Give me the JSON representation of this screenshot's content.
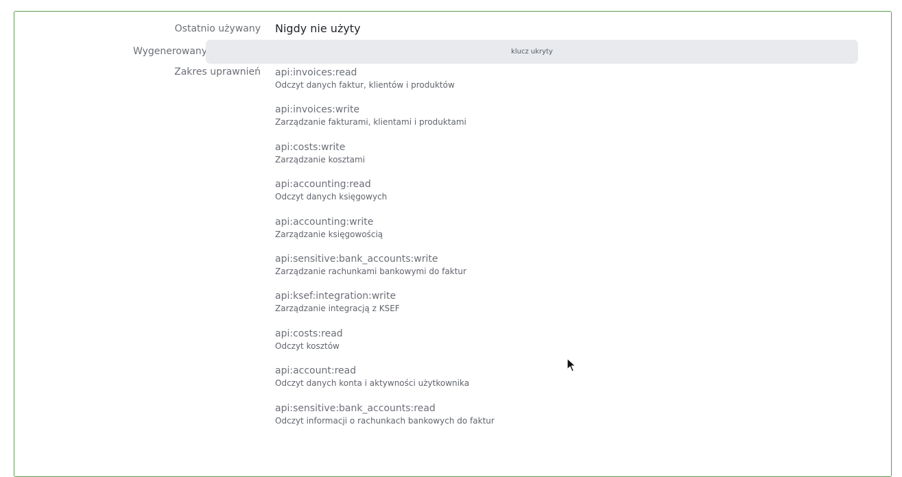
{
  "fields": {
    "last_used_label": "Ostatnio używany",
    "last_used_value": "Nigdy nie użyty",
    "generated_label": "Wygenerowany",
    "hidden_key_text": "klucz ukryty",
    "scope_label": "Zakres uprawnień"
  },
  "scopes": [
    {
      "name": "api:invoices:read",
      "desc": "Odczyt danych faktur, klientów i produktów"
    },
    {
      "name": "api:invoices:write",
      "desc": "Zarządzanie fakturami, klientami i produktami"
    },
    {
      "name": "api:costs:write",
      "desc": "Zarządzanie kosztami"
    },
    {
      "name": "api:accounting:read",
      "desc": "Odczyt danych księgowych"
    },
    {
      "name": "api:accounting:write",
      "desc": "Zarządzanie księgowością"
    },
    {
      "name": "api:sensitive:bank_accounts:write",
      "desc": "Zarządzanie rachunkami bankowymi do faktur"
    },
    {
      "name": "api:ksef:integration:write",
      "desc": "Zarządzanie integracją z KSEF"
    },
    {
      "name": "api:costs:read",
      "desc": "Odczyt kosztów"
    },
    {
      "name": "api:account:read",
      "desc": "Odczyt danych konta i aktywności użytkownika"
    },
    {
      "name": "api:sensitive:bank_accounts:read",
      "desc": "Odczyt informacji o rachunkach bankowych do faktur"
    }
  ],
  "colors": {
    "panel_border": "#5a9a4e",
    "hidden_key_bg": "#e8eaee"
  },
  "icons": {
    "cursor": "mouse-pointer-icon"
  }
}
